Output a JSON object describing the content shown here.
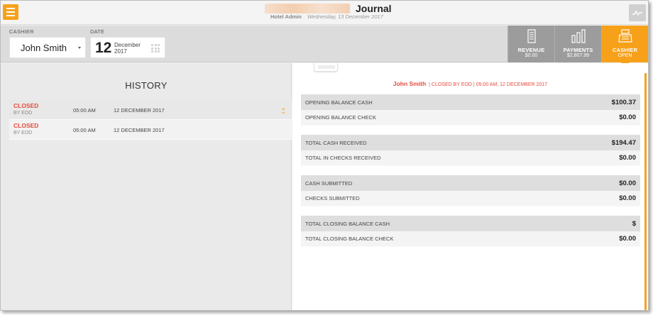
{
  "header": {
    "title": "Journal",
    "user_role": "Hotel Admin",
    "current_date": "Wednesday, 13 December 2017"
  },
  "filters": {
    "cashier_label": "CASHIER",
    "cashier_value": "John Smith",
    "date_label": "DATE",
    "date_day": "12",
    "date_month": "December",
    "date_year": "2017"
  },
  "tabs": [
    {
      "label": "REVENUE",
      "sub": "$0.00",
      "icon": "cash-register-icon"
    },
    {
      "label": "PAYMENTS",
      "sub": "$2,807.99",
      "icon": "bar-chart-icon"
    },
    {
      "label": "CASHIER",
      "sub": "OPEN",
      "icon": "cashier-icon",
      "active": true
    }
  ],
  "history": {
    "title": "HISTORY",
    "rows": [
      {
        "status": "CLOSED",
        "by": "BY EOD",
        "time": "05:00 AM",
        "date": "12 DECEMBER 2017",
        "expand_icon": "double-chevron-down-icon"
      },
      {
        "status": "CLOSED",
        "by": "BY EOD",
        "time": "05:00 AM",
        "date": "12 DECEMBER 2017"
      }
    ]
  },
  "detail": {
    "cashier_name": "John Smith",
    "status_line": "| CLOSED BY EOD | 05:00 AM, 12 DECEMBER 2017",
    "blocks": [
      {
        "head_label": "OPENING BALANCE CASH",
        "head_value": "$100.37",
        "sub_label": "OPENING BALANCE CHECK",
        "sub_value": "$0.00"
      },
      {
        "head_label": "TOTAL CASH RECEIVED",
        "head_value": "$194.47",
        "sub_label": "TOTAL IN CHECKS RECEIVED",
        "sub_value": "$0.00"
      },
      {
        "head_label": "CASH SUBMITTED",
        "head_value": "$0.00",
        "sub_label": "CHECKS SUBMITTED",
        "sub_value": "$0.00"
      },
      {
        "head_label": "TOTAL CLOSING BALANCE CASH",
        "head_value": "$",
        "sub_label": "TOTAL CLOSING BALANCE CHECK",
        "sub_value": "$0.00"
      }
    ]
  },
  "colors": {
    "accent": "#f7a11a",
    "closed_status": "#e44b3c",
    "tab_inactive": "#9c9c9c"
  }
}
